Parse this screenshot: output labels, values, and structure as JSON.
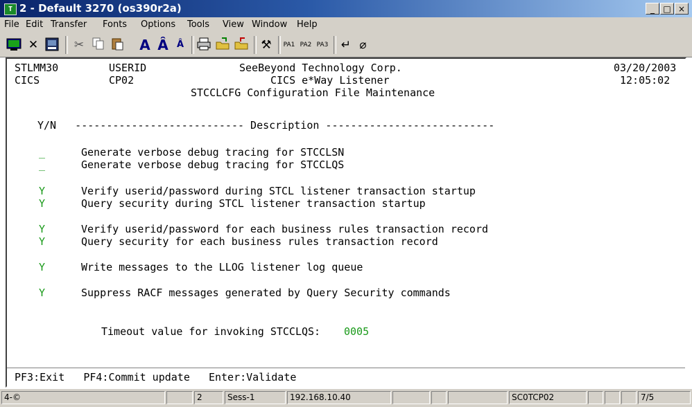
{
  "window": {
    "title": "2 - Default 3270 (os390r2a)",
    "minimize": "_",
    "maximize": "□",
    "close": "×"
  },
  "menu": [
    "File",
    "Edit",
    "Transfer",
    "Fonts",
    "Options",
    "Tools",
    "View",
    "Window",
    "Help"
  ],
  "toolbar": {
    "pa1": "PA1",
    "pa2": "PA2",
    "pa3": "PA3"
  },
  "screen": {
    "header": {
      "system": "STLMM30",
      "region": "CICS",
      "userid": "USERID",
      "terminal": "CP02",
      "company": "SeeBeyond Technology Corp.",
      "product": "CICS e*Way Listener",
      "screen_title": "STCCLCFG Configuration File Maintenance",
      "date": "03/20/2003",
      "time": "12:05:02"
    },
    "column_header": "Y/N   --------------------------- Description ---------------------------",
    "options": [
      {
        "value": "_",
        "description": "Generate verbose debug tracing for STCCLSN"
      },
      {
        "value": "_",
        "description": "Generate verbose debug tracing for STCCLQS"
      },
      {
        "value": "Y",
        "description": "Verify userid/password during STCL listener transaction startup"
      },
      {
        "value": "Y",
        "description": "Query security during STCL listener transaction startup"
      },
      {
        "value": "Y",
        "description": "Verify userid/password for each business rules transaction record"
      },
      {
        "value": "Y",
        "description": "Query security for each business rules transaction record"
      },
      {
        "value": "Y",
        "description": "Write messages to the LLOG listener log queue"
      },
      {
        "value": "Y",
        "description": "Suppress RACF messages generated by Query Security commands"
      }
    ],
    "timeout_label": "Timeout value for invoking STCCLQS:",
    "timeout_value": "0005",
    "pf_keys": "PF3:Exit   PF4:Commit update   Enter:Validate"
  },
  "status_bar": {
    "indicator": "4-©",
    "screen_num": "2",
    "session": "Sess-1",
    "host": "192.168.10.40",
    "lu": "SC0TCP02",
    "cursor": "7/5"
  },
  "colors": {
    "field_green": "#1a9a1a",
    "titlebar": "#0a246a"
  }
}
